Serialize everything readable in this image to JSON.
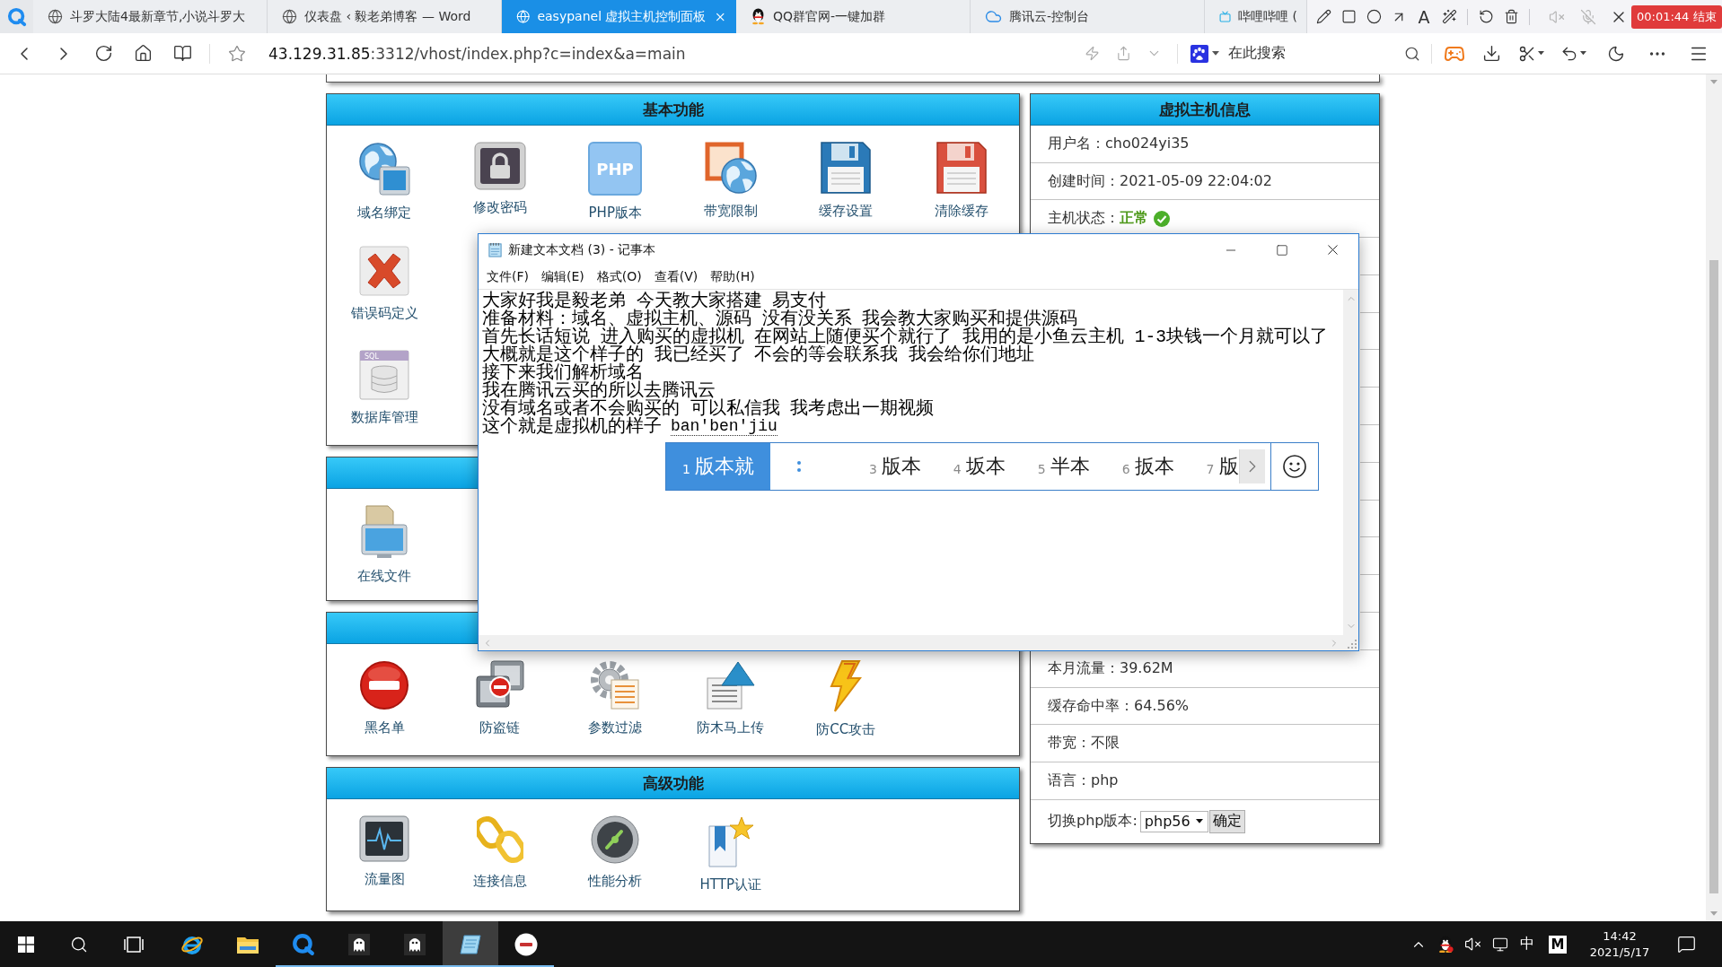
{
  "browser": {
    "tabs": [
      {
        "title": "斗罗大陆4最新章节,小说斗罗大",
        "selected": false
      },
      {
        "title": "仪表盘 ‹ 毅老弟博客 — Word",
        "selected": false
      },
      {
        "title": "easypanel 虚拟主机控制面板",
        "selected": true
      },
      {
        "title": "QQ群官网-一键加群",
        "selected": false
      },
      {
        "title": "腾讯云-控制台",
        "selected": false
      },
      {
        "title": "哔哩哔哩 (",
        "selected": false
      }
    ],
    "recorder": {
      "text_tool": "A",
      "timer": "00:01:44 结束"
    },
    "address": {
      "host": "43.129.31.85",
      "path": ":3312/vhost/index.php?c=index&a=main"
    },
    "search": {
      "placeholder": "在此搜索"
    }
  },
  "panels": [
    {
      "title": "基本功能",
      "rows": [
        [
          {
            "label": "域名绑定"
          },
          {
            "label": "修改密码"
          },
          {
            "label": "PHP版本",
            "icon_text": "PHP"
          },
          {
            "label": "带宽限制"
          },
          {
            "label": "缓存设置"
          },
          {
            "label": "清除缓存"
          }
        ],
        [
          {
            "label": "错误码定义"
          }
        ],
        [
          {
            "label": "数据库管理",
            "icon_text": "SQL"
          }
        ]
      ]
    },
    {
      "rows": [
        [
          {
            "label": "在线文件"
          }
        ]
      ]
    },
    {
      "rows": [
        [
          {
            "label": "黑名单"
          },
          {
            "label": "防盗链"
          },
          {
            "label": "参数过滤"
          },
          {
            "label": "防木马上传"
          },
          {
            "label": "防CC攻击"
          }
        ]
      ]
    },
    {
      "title": "高级功能",
      "rows": [
        [
          {
            "label": "流量图"
          },
          {
            "label": "连接信息"
          },
          {
            "label": "性能分析"
          },
          {
            "label": "HTTP认证"
          }
        ]
      ]
    }
  ],
  "host_info": {
    "title": "虚拟主机信息",
    "upper_rows": [
      {
        "kind": "text",
        "text": "用户名：cho024yi35"
      },
      {
        "kind": "text",
        "text": "创建时间：2021-05-09 22:04:02"
      },
      {
        "kind": "status",
        "label": "主机状态：",
        "value": "正常",
        "ok": true
      }
    ],
    "lower_rows": [
      {
        "kind": "text",
        "text": "本月流量：39.62M"
      },
      {
        "kind": "text",
        "text": "缓存命中率：64.56%"
      },
      {
        "kind": "text",
        "text": "带宽：不限"
      },
      {
        "kind": "text",
        "text": "语言：php"
      }
    ],
    "version_switch": {
      "label": "切换php版本:",
      "value": "php56",
      "button": "确定"
    }
  },
  "notepad": {
    "title": "新建文本文档 (3) - 记事本",
    "menu": [
      "文件(F)",
      "编辑(E)",
      "格式(O)",
      "查看(V)",
      "帮助(H)"
    ],
    "lines": [
      "大家好我是毅老弟 今天教大家搭建 易支付",
      "准备材料：域名、虚拟主机、源码 没有没关系 我会教大家购买和提供源码",
      "首先长话短说 进入购买的虚拟机 在网站上随便买个就行了 我用的是小鱼云主机 1-3块钱一个月就可以了",
      "大概就是这个样子的 我已经买了 不会的等会联系我 我会给你们地址",
      "接下来我们解析域名",
      "我在腾讯云买的所以去腾讯云",
      "没有域名或者不会购买的 可以私信我 我考虑出一期视频",
      "这个就是虚拟机的样子"
    ],
    "composition": "ban'ben'jiu",
    "candidates": [
      {
        "kind": "word",
        "index": "1",
        "text": "版本就",
        "selected": true
      },
      {
        "kind": "pending",
        "selected": false
      },
      {
        "kind": "word",
        "index": "3",
        "text": "版本",
        "selected": false
      },
      {
        "kind": "word",
        "index": "4",
        "text": "坂本",
        "selected": false
      },
      {
        "kind": "word",
        "index": "5",
        "text": "半本",
        "selected": false
      },
      {
        "kind": "word",
        "index": "6",
        "text": "扳本",
        "selected": false
      },
      {
        "kind": "word",
        "index": "7",
        "text": "版",
        "selected": false
      }
    ]
  },
  "taskbar": {
    "apps": [
      {
        "running": false,
        "selected": false
      },
      {
        "running": false,
        "selected": false
      },
      {
        "running": true,
        "selected": false
      },
      {
        "running": true,
        "selected": false
      },
      {
        "running": true,
        "selected": false
      },
      {
        "running": true,
        "selected": true
      },
      {
        "running": true,
        "selected": false
      }
    ],
    "tray": {
      "ime": "中",
      "app_letter": "M"
    },
    "clock": {
      "time": "14:42",
      "date": "2021/5/17"
    }
  }
}
